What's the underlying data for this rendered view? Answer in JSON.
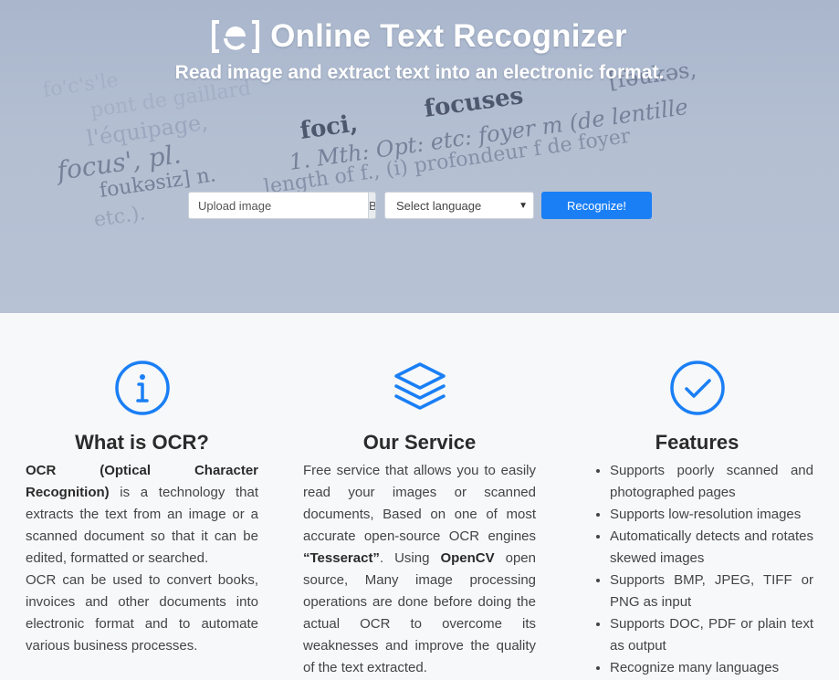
{
  "header": {
    "title": "Online Text Recognizer",
    "tagline": "Read image and extract text into an electronic format."
  },
  "hero_background_text": [
    "l'équipage,",
    "pont de gaillard",
    "fo'c's'le",
    "foci,",
    "focuses",
    "[fəukəs,",
    "focus', pl.",
    "1. Mth: Opt: etc: foyer m (de lentille",
    "foukəsiz] n.",
    "length of f., (i) profondeur f de foyer",
    "etc.)."
  ],
  "form": {
    "upload_placeholder": "Upload image",
    "browse_label": "Browse",
    "language_selected": "Select language",
    "recognize_label": "Recognize!"
  },
  "sections": {
    "ocr": {
      "icon": "info-icon",
      "title": "What is OCR?",
      "p1_bold_term": "OCR (Optical Character Recognition)",
      "p1_rest": " is a technology that extracts the text from an image or a scanned document so that it can be edited, formatted or searched.",
      "p2": "OCR can be used to convert books, invoices and other documents into electronic format and to automate various business processes."
    },
    "service": {
      "icon": "layers-icon",
      "title": "Our Service",
      "text_start": "Free service that allows you to easily read your images or scanned documents, Based on one of most accurate open-source OCR engines ",
      "engine": "“Tesseract”",
      "text_mid": ". Using ",
      "library": "OpenCV",
      "text_end": " open source, Many image processing operations are done before doing the actual OCR to overcome its weaknesses and improve the quality of the text extracted."
    },
    "features": {
      "icon": "check-circle-icon",
      "title": "Features",
      "items": [
        "Supports poorly scanned and photographed pages",
        "Supports low-resolution images",
        "Automatically detects and rotates skewed images",
        "Supports BMP, JPEG, TIFF or PNG as input",
        "Supports DOC, PDF or plain text as output",
        "Recognize many languages"
      ]
    }
  },
  "colors": {
    "accent": "#1a7ff5",
    "hero_bg": "#b4bfd2",
    "section_bg": "#f7f8fa"
  }
}
